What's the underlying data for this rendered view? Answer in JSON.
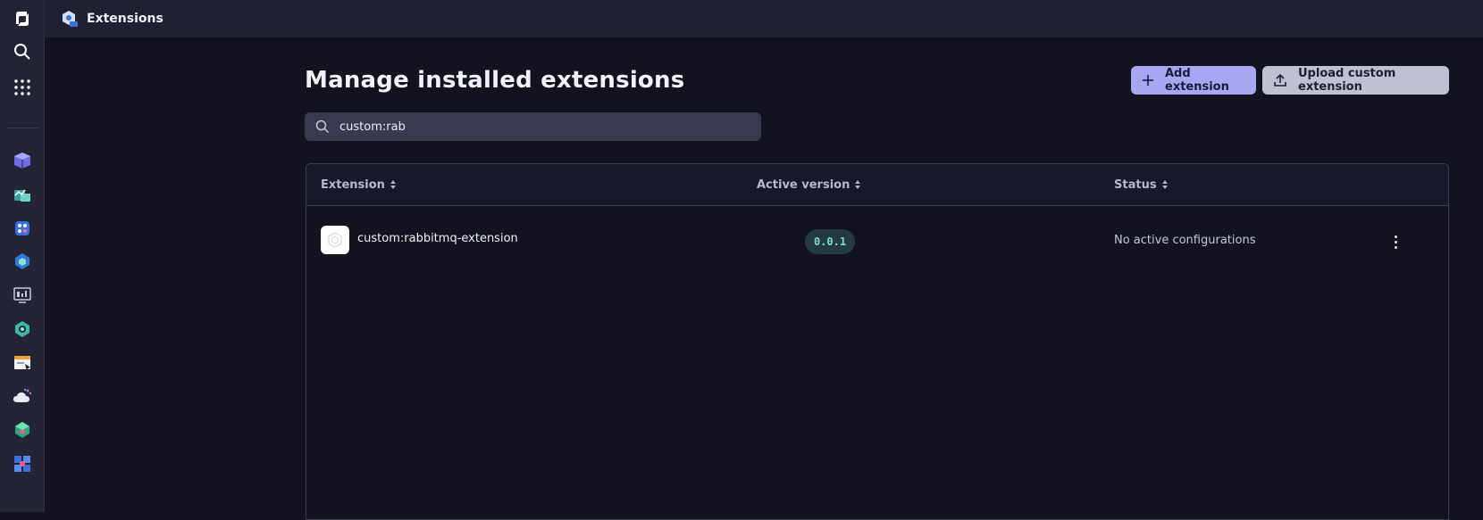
{
  "topbar": {
    "title": "Extensions",
    "app_icon": "extensions-app-icon"
  },
  "rail": {
    "top_items": [
      "dynatrace-logo-icon",
      "search-icon",
      "apps-grid-icon"
    ],
    "apps": [
      "hub-cube-icon",
      "infrastructure-icon",
      "kubernetes-icon",
      "extensions-icon",
      "dashboards-icon",
      "services-icon",
      "notebooks-icon",
      "cloud-icon",
      "workflows-icon",
      "settings-tiles-icon"
    ]
  },
  "page": {
    "title": "Manage installed extensions",
    "add_button": "Add extension",
    "upload_button": "Upload custom extension"
  },
  "search": {
    "value": "custom:rab"
  },
  "table": {
    "columns": [
      "Extension",
      "Active version",
      "Status"
    ],
    "rows": [
      {
        "name": "custom:rabbitmq-extension",
        "version": "0.0.1",
        "status": "No active configurations"
      }
    ]
  },
  "colors": {
    "accent": "#a8a6f2",
    "version_text": "#7fe0c8",
    "background": "#12131f"
  }
}
